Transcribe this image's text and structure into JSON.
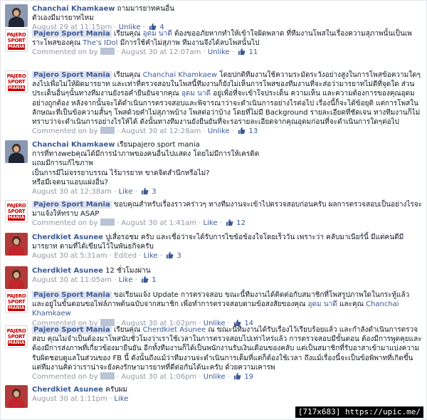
{
  "colors": {
    "link": "#3b5998",
    "meta": "#9197a3",
    "text": "#141823",
    "page_tag_bg": "#dfe3ee",
    "brand_red": "#c40000"
  },
  "logo": {
    "line1": "PAJERO",
    "line2": "SPORT",
    "line3": "MANIA"
  },
  "comments": [
    {
      "author": "Chanchai Khamkaew",
      "text": "ถามมารยาทคนอื่น\nตัวเองมีมารยาทไหม",
      "time": "August 29 at 11:15pm",
      "actions": [
        "Unlike"
      ],
      "likes": "4"
    },
    {
      "author": "Pajero Sport Mania",
      "text_pre": "เรียนคุณ ",
      "tag1": "อุดม นาดี",
      "text_mid": " ต้องขออภัยหากทำให้เข้าใจผิดพลาด ที่ทีมงานโพสในเรื่องความสุภาพนั้นเป็นเพราะโพสของคุณ ",
      "tag2": "The's IDol",
      "text_post": " มีการใช้คำไม่สุภาพ ทีมงานจึงได้ลบโพสนั้นไป",
      "commented_on": "Commented on by",
      "time": "August 30 at 12:07am",
      "actions": [
        "Unlike"
      ],
      "likes": "11"
    },
    {
      "author": "Pajero Sport Mania",
      "text_pre": "เรียนคุณ ",
      "tag1": "Chanchai Khamkaew",
      "text_mid": " โดยปกติทีมงานใช้ความระมัดระวังอย่างสูงในการโพสข้อความใดๆลงไปเพื่อไม่ให้ผิดมารยาท และเท่าที่ตรวจสอบในโพสนี้ทีมงานก็ยังไม่เห็นการโพสของทีมงานที่จะส่อว่ามารยาทไม่ดีที่จุดใด ส่วนประเด็นอื่นๆนั้นทางทีมงานยังรอคำยืนยันจากคุณ ",
      "tag2": "อุดม นาดี",
      "text_post": " อยู่เพื่อที่จะเข้าใจประเด็น ความเห็น และความต้องการของคุณอุดมอย่างถูกต้อง หลังจากนั้นจะได้ดำเนินการตรวจสอบและพิจารณาว่าจะดำเนินการอย่างไรต่อไป เรื่องนี้ก็จะได้ข้อยุติ แต่การโพสในลักษณะที่เป็นข้อความสั้นๆ โพสด้วยคำไม่สุภาพบ้าง โพสต่อว่าบ้าง โดยที่ไม่มี Background รายละเอียดที่ชัดเจน ทางทีมงานก็ไม่ทราบว่าจะดำเนินการอย่างไรให้ได้ ดังนั้นทางทีมงานยังยืนยันที่จะรอรายละเอียดจากคุณอุดมก่อนที่จะดำเนินการใดๆต่อไป",
      "commented_on": "Commented on by",
      "time": "August 30 at 12:28am",
      "actions": [
        "Unlike"
      ],
      "likes": "13"
    },
    {
      "author": "Chanchai Khamkaew",
      "text": "เรียนpajero sport mania\nการที่ทางwebคุณได้มีการนำภาพของคนอื่นไปแสดง โดยไม่มีการให้เครดิต\nแถมมีการแก้ไขภาพ\nเป็นการมีไม่จรรยาบรรณ ไร้มารยาท ขาดจิตสำนึกหรือไม่?\nหรือมีเจตนาแอบแฝงอื่น?",
      "time": "August 30 at 12:38am",
      "actions": [
        "Like"
      ],
      "likes": "3"
    },
    {
      "author": "Pajero Sport Mania",
      "text": "ขอบคุณสำหรับเรื่องราวคร่าวๆ ทางทีมงานจะเข้าไปตรวจสอบก่อนครับ ผลการตรวจสอบเป็นอย่างไรจะมาแจ้งให้ทราบ ASAP",
      "commented_on": "Commented on by",
      "time": "August 30 at 1:41am",
      "actions": [
        "Like"
      ],
      "likes": "12"
    },
    {
      "author": "Cherdkiet Asunee",
      "text": "ปูเสื่อรอชม ครับ และเชื่อว่าจะได้รับการไขข้อข้องใจโดยเร็ววัน เพราะว่า คลับมาเนียร์นี้ มีแต่คนดีมีมารยาท ตามที่ได้เขียนไว้ในพันธกิจครับ",
      "time": "August 30 at 5:31am",
      "edited": "Edited",
      "actions": [
        "Like"
      ],
      "likes": "3"
    },
    {
      "author": "Cherdkiet Asunee",
      "text": "12 ชั่วโมงผ่าน",
      "time": "August 30 at 11:05am",
      "actions": [
        "Like"
      ],
      "likes": "1"
    },
    {
      "author": "Pajero Sport Mania",
      "text_pre": "ขอเรียนแจ้ง Update การตรวจสอบ ขณะนี้ทีมงานได้ติดต่อกับสมาชิกที่โพสรูปภาพใดในกระทู้แล้ว และอยู่ในขั้นตอนขอไฟล์ภาพต้นฉบับจากสมาชิก เพื่อทำการตรวจสอบตามข้อสงสัยของคุณ ",
      "tag1": "อุดม นาดี",
      "text_mid": " และคุณ ",
      "tag2": "Chanchai Khamkaew",
      "text_post": "",
      "commented_on": "Commented on by",
      "time": "August 30 at 1:02pm",
      "actions": [
        "Unlike"
      ],
      "likes": "14"
    },
    {
      "author": "Pajero Sport Mania",
      "text_pre": "เรียนคุณ ",
      "tag1": "Cherdkiet Asunee",
      "text_mid": " ณ ขณะนี้ทีมงานได้รับเรื่องไว้เรียบร้อยแล้ว และกำลังดำเนินการตรวจสอบ คุณไม่จำเป็นต้องมาโพสนับชั่วโมงว่าเราใช้เวลาในการตรวจสอบไปเท่าไหร่แล้ว การตรวจสอบมีขั้นตอน ต้องมีการพูดคุยและต้องมีการส่งภาพที่เกี่ยวข้องมายืนยัน อีกทั้งทีมงานก็ได้เป็นพนักงานรับเงินเดือนของคลับ แต่เป็นสมาชิกที่รับอาสาเข้ามาแบ่งความรับผิดชอบดูแลในส่วนของ FB นี้ ดังนั้นถึงแม้ว่าทีมงานจะดำเนินการเต็มที่แต่ก็ต้องใช้เวลา ถึงแม้เรื่องนี้จะเป็นข้อพิพาทที่เกิดขึ้น แต่ทีมงานคิดว่าเราน่าจะยังคงรักษามารยาทที่ดีต่อกันได้นะครับ ด้วยความเคารพ",
      "tag2": "",
      "text_post": "",
      "commented_on": "Commented on by",
      "time": "August 30 at 1:06pm",
      "actions": [
        "Unlike"
      ],
      "likes": "19"
    },
    {
      "author": "Cherdkiet Asunee",
      "text": "ครับผม",
      "time": "August 30 at 1:11pm",
      "actions": [
        "Like"
      ],
      "likes": ""
    }
  ],
  "watermark": "[717x683] https://upic.me/"
}
